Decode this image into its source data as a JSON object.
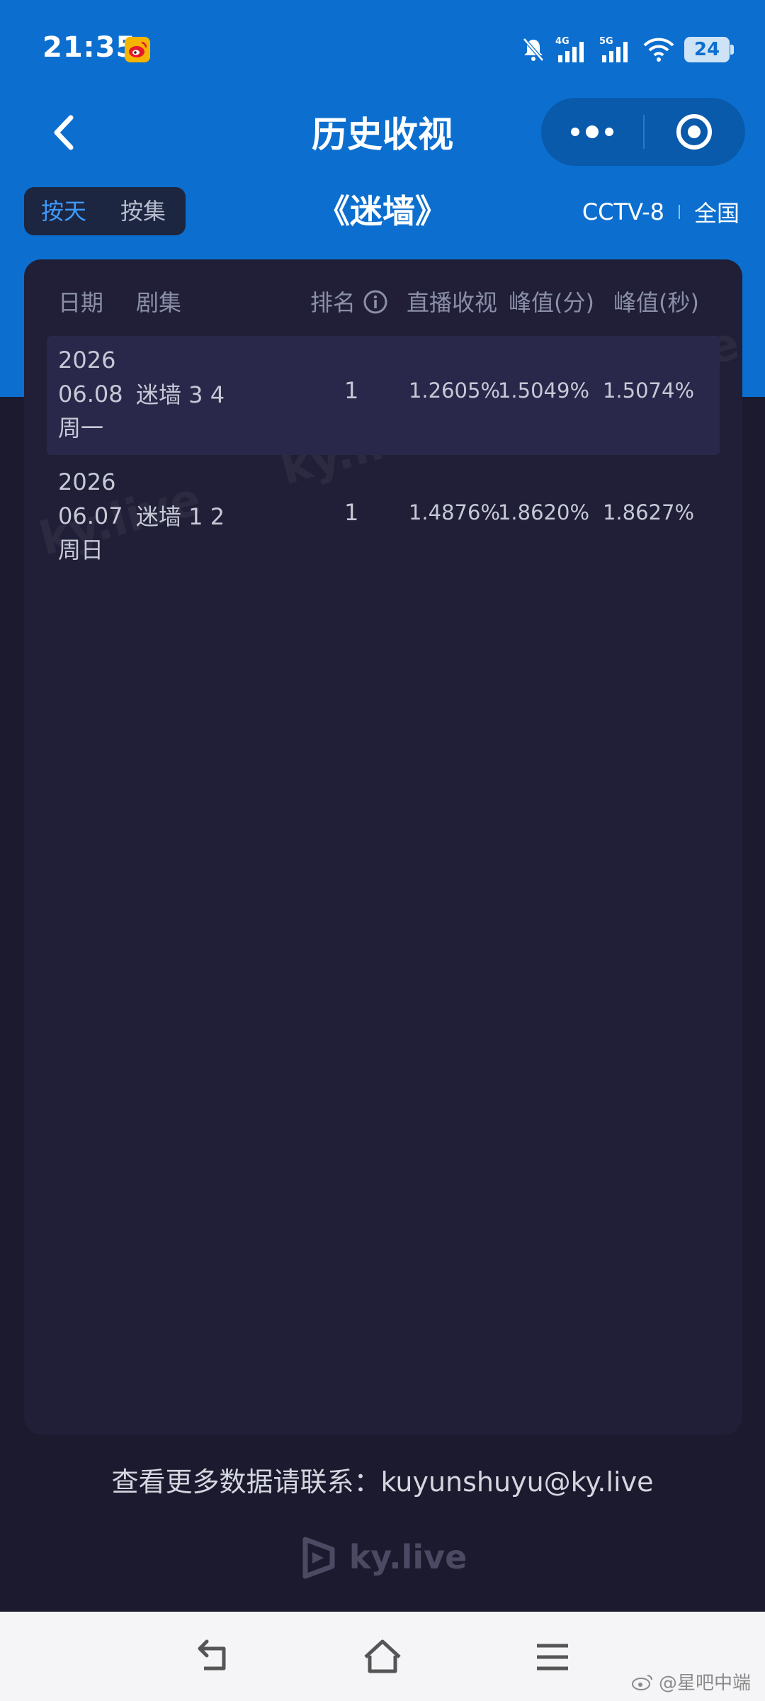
{
  "status_bar": {
    "time": "21:35",
    "app_icon": "weibo-icon",
    "signal_1_label": "4G",
    "signal_2_label": "5G",
    "battery": "24"
  },
  "nav": {
    "title": "历史收视",
    "back_icon": "back-chevron-icon",
    "more_icon": "more-dots-icon",
    "record_icon": "target-circle-icon"
  },
  "toggle": {
    "by_day": "按天",
    "by_episode": "按集",
    "active": "按天"
  },
  "drama_title": "《迷墙》",
  "channel": {
    "name": "CCTV-8",
    "region": "全国"
  },
  "table": {
    "headers": {
      "date": "日期",
      "episode": "剧集",
      "rank": "排名",
      "live_rating": "直播收视",
      "peak_min": "峰值(分)",
      "peak_sec": "峰值(秒)"
    },
    "rows": [
      {
        "year": "2026",
        "date": "06.08",
        "weekday": "周一",
        "episode": "迷墙 3 4",
        "rank": "1",
        "live_rating": "1.2605%",
        "peak_min": "1.5049%",
        "peak_sec": "1.5074%"
      },
      {
        "year": "2026",
        "date": "06.07",
        "weekday": "周日",
        "episode": "迷墙 1 2",
        "rank": "1",
        "live_rating": "1.4876%",
        "peak_min": "1.8620%",
        "peak_sec": "1.8627%"
      }
    ]
  },
  "watermark_text": "ky.live",
  "contact_text": "查看更多数据请联系：kuyunshuyu@ky.live",
  "footer_logo_text": "ky.live",
  "credit": "@星吧中端",
  "colors": {
    "header_blue": "#0c6fcf",
    "background": "#1b1a2e",
    "card": "#201f37",
    "active_tab": "#3d9bff"
  }
}
